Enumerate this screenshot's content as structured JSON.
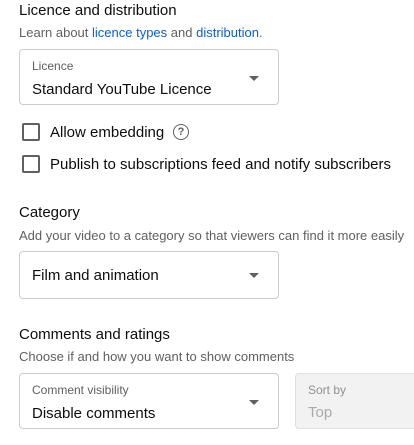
{
  "licence": {
    "title": "Licence and distribution",
    "sub_prefix": "Learn about ",
    "link_types": "licence types",
    "sub_and": " and ",
    "link_distribution": "distribution",
    "sub_suffix": ".",
    "select_label": "Licence",
    "select_value": "Standard YouTube Licence"
  },
  "options": {
    "allow_embedding": "Allow embedding",
    "allow_embedding_checked": false,
    "help_icon_glyph": "?",
    "publish_feed": "Publish to subscriptions feed and notify subscribers",
    "publish_feed_checked": false
  },
  "category": {
    "title": "Category",
    "subtitle": "Add your video to a category so that viewers can find it more easily",
    "select_value": "Film and animation"
  },
  "comments": {
    "title": "Comments and ratings",
    "subtitle": "Choose if and how you want to show comments",
    "visibility_label": "Comment visibility",
    "visibility_value": "Disable comments",
    "sort_label": "Sort by",
    "sort_value": "Top"
  }
}
